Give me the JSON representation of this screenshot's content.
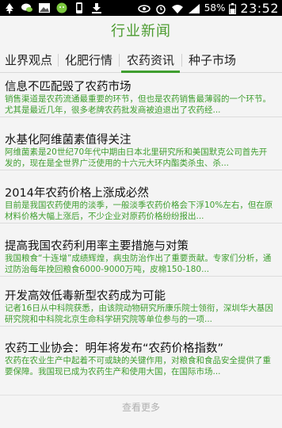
{
  "status_bar": {
    "battery": "58%",
    "time": "23:52"
  },
  "header": {
    "title": "行业新闻"
  },
  "tabs": [
    {
      "label": "业界观点"
    },
    {
      "label": "化肥行情"
    },
    {
      "label": "农药资讯",
      "active": true
    },
    {
      "label": "种子市场"
    }
  ],
  "news": [
    {
      "title": "信息不匹配毁了农药市场",
      "summary": "销售渠道是农药流通最重要的环节，但也是农药销售最薄弱的一个环节。尤其是最近几年，很多老牌农药批发商被迫退出了农药经..."
    },
    {
      "title": "水基化阿维菌素值得关注",
      "summary": "阿维菌素是20世纪70年代中期由日本北里研究所和美国默克公司首先开发的，现在是全世界广泛使用的十六元大环内酯类杀虫、杀..."
    },
    {
      "title": "2014年农药价格上涨成必然",
      "summary": "目前是我国农药使用的淡季，一般淡季农药价格会下浮10%左右，但在原材料价格大幅上涨后，不少企业对原药价格纷纷报出..."
    },
    {
      "title": "提高我国农药利用率主要措施与对策",
      "summary": "我国粮食“十连增”成绩辉煌，病虫防治作出了重要贡献。专家们分析，通过防治每年挽回粮食6000-9000万吨，皮棉150-180..."
    },
    {
      "title": "开发高效低毒新型农药成为可能",
      "summary": "记者16日从中科院获悉，由该院动物研究所康乐院士领衔，深圳华大基因研究院和中科院北京生命科学研究院等单位参与的一项..."
    },
    {
      "title": "农药工业协会：明年将发布“农药价格指数”",
      "summary": "农药在农业生产中起着不可或缺的关键作用，对粮食和食品安全提供了重要保障。我国现已成为农药生产和使用大国，在国际市场..."
    }
  ],
  "more_label": "查看更多",
  "colors": {
    "accent": "#3f9e2f",
    "title_green": "#4b9b2f"
  }
}
